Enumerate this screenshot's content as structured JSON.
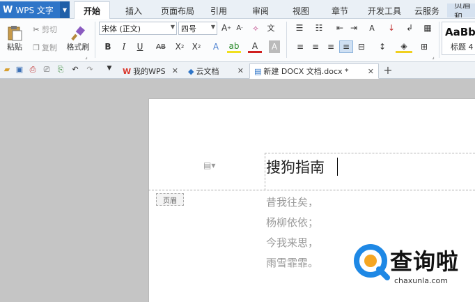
{
  "app": {
    "name": "WPS 文字"
  },
  "menu_tabs": [
    {
      "label": "开始",
      "active": true
    },
    {
      "label": "插入"
    },
    {
      "label": "页面布局"
    },
    {
      "label": "引用"
    },
    {
      "label": "审阅"
    },
    {
      "label": "视图"
    },
    {
      "label": "章节"
    },
    {
      "label": "开发工具"
    },
    {
      "label": "云服务"
    },
    {
      "label": "页眉和"
    }
  ],
  "ribbon": {
    "paste": "粘贴",
    "cut": "剪切",
    "copy": "复制",
    "format_painter": "格式刷",
    "font_name": "宋体 (正文)",
    "font_size": "四号",
    "style_preview": "AaBb",
    "style_name": "标题 4"
  },
  "doc_tabs": [
    {
      "label": "我的WPS"
    },
    {
      "label": "云文档"
    },
    {
      "label": "新建 DOCX 文档.docx *",
      "active": true
    }
  ],
  "document": {
    "header_label": "页眉",
    "header_text": "搜狗指南",
    "body_lines": [
      "昔我往矣，",
      "杨柳依依；",
      "今我来思，",
      "雨雪霏霏。"
    ]
  },
  "watermark": {
    "title": "查询啦",
    "domain": "chaxunla.com"
  },
  "colors": {
    "accent": "#2e75c8",
    "wps_red": "#d9352a",
    "watermark_blue": "#1e88e5",
    "watermark_orange": "#f5a623"
  }
}
